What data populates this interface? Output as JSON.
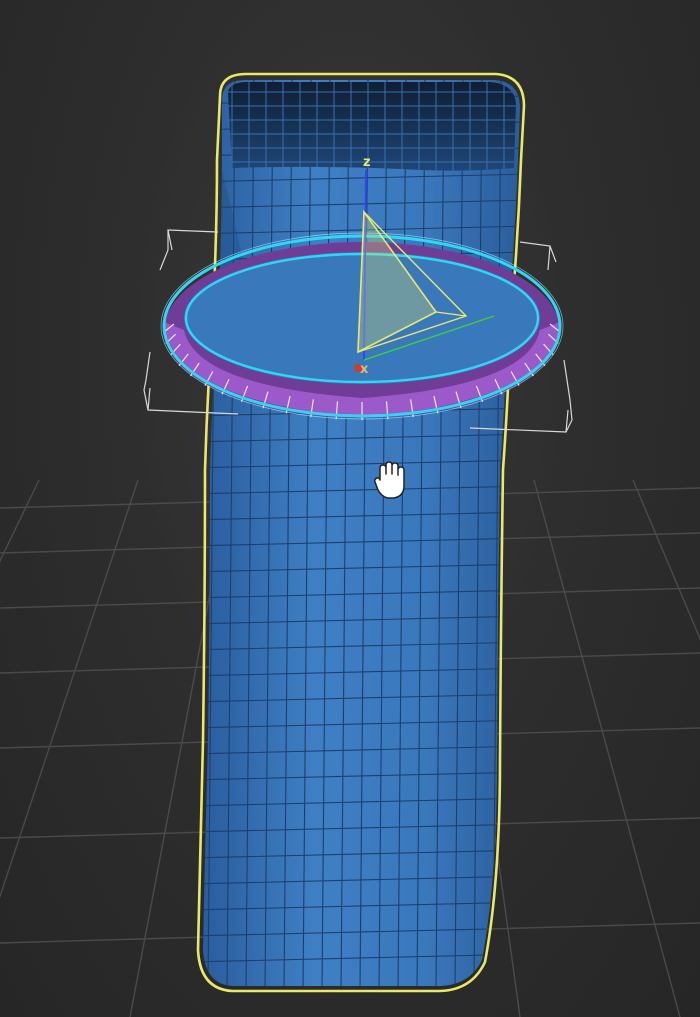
{
  "viewport": {
    "background_color": "#2b2b2b",
    "grid_color": "#5a5a5a"
  },
  "object": {
    "mesh_fill": "#3f7fc4",
    "mesh_dark": "#2c5c96",
    "wire_color": "#1d3f6b",
    "selection_outline_color": "#e8e86a"
  },
  "gizmo": {
    "ring_color": "#2fd8f2",
    "ring_fill": "#9b59c9",
    "ring_fill_dark": "#6f3d96",
    "bracket_color": "#d8d8d8",
    "pivot_color": "#e8e86a",
    "axes": {
      "z": "z",
      "x": "x",
      "z_color": "#2a48ff",
      "x_color": "#d23a2a",
      "y_color": "#3ad23a"
    }
  },
  "cursor": {
    "icon": "hand-pan-icon"
  }
}
